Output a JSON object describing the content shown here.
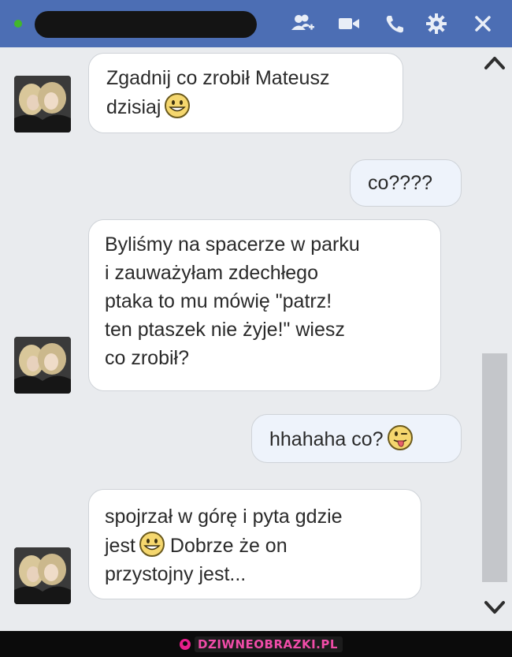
{
  "window": {
    "status": "online",
    "title_bar_icons": [
      "add-friend-icon",
      "video-call-icon",
      "phone-icon",
      "gear-icon",
      "close-icon"
    ]
  },
  "messages": [
    {
      "side": "in",
      "text_before": "Zgadnij co zrobił Mateusz\ndzisiaj",
      "emoji": "smile",
      "text_after": ""
    },
    {
      "side": "out",
      "text_before": "co????",
      "emoji": null,
      "text_after": ""
    },
    {
      "side": "in",
      "text_before": "Byliśmy na spacerze w parku\ni zauważyłam zdechłego\nptaka to mu mówię \"patrz!\nten ptaszek nie żyje!\" wiesz\nco zrobił?",
      "emoji": null,
      "text_after": ""
    },
    {
      "side": "out",
      "text_before": "hhahaha co?",
      "emoji": "tongue",
      "text_after": ""
    },
    {
      "side": "in",
      "text_before": "spojrzał w górę i pyta gdzie\njest",
      "emoji": "smile",
      "text_after": "Dobrze że on\nprzystojny jest..."
    }
  ],
  "watermark": {
    "text": "DZIWNEOBRAZKI.PL"
  },
  "colors": {
    "titlebar": "#4c6eb4",
    "background": "#e9ebee",
    "outgoing": "#eef3fb",
    "incoming": "#ffffff"
  }
}
